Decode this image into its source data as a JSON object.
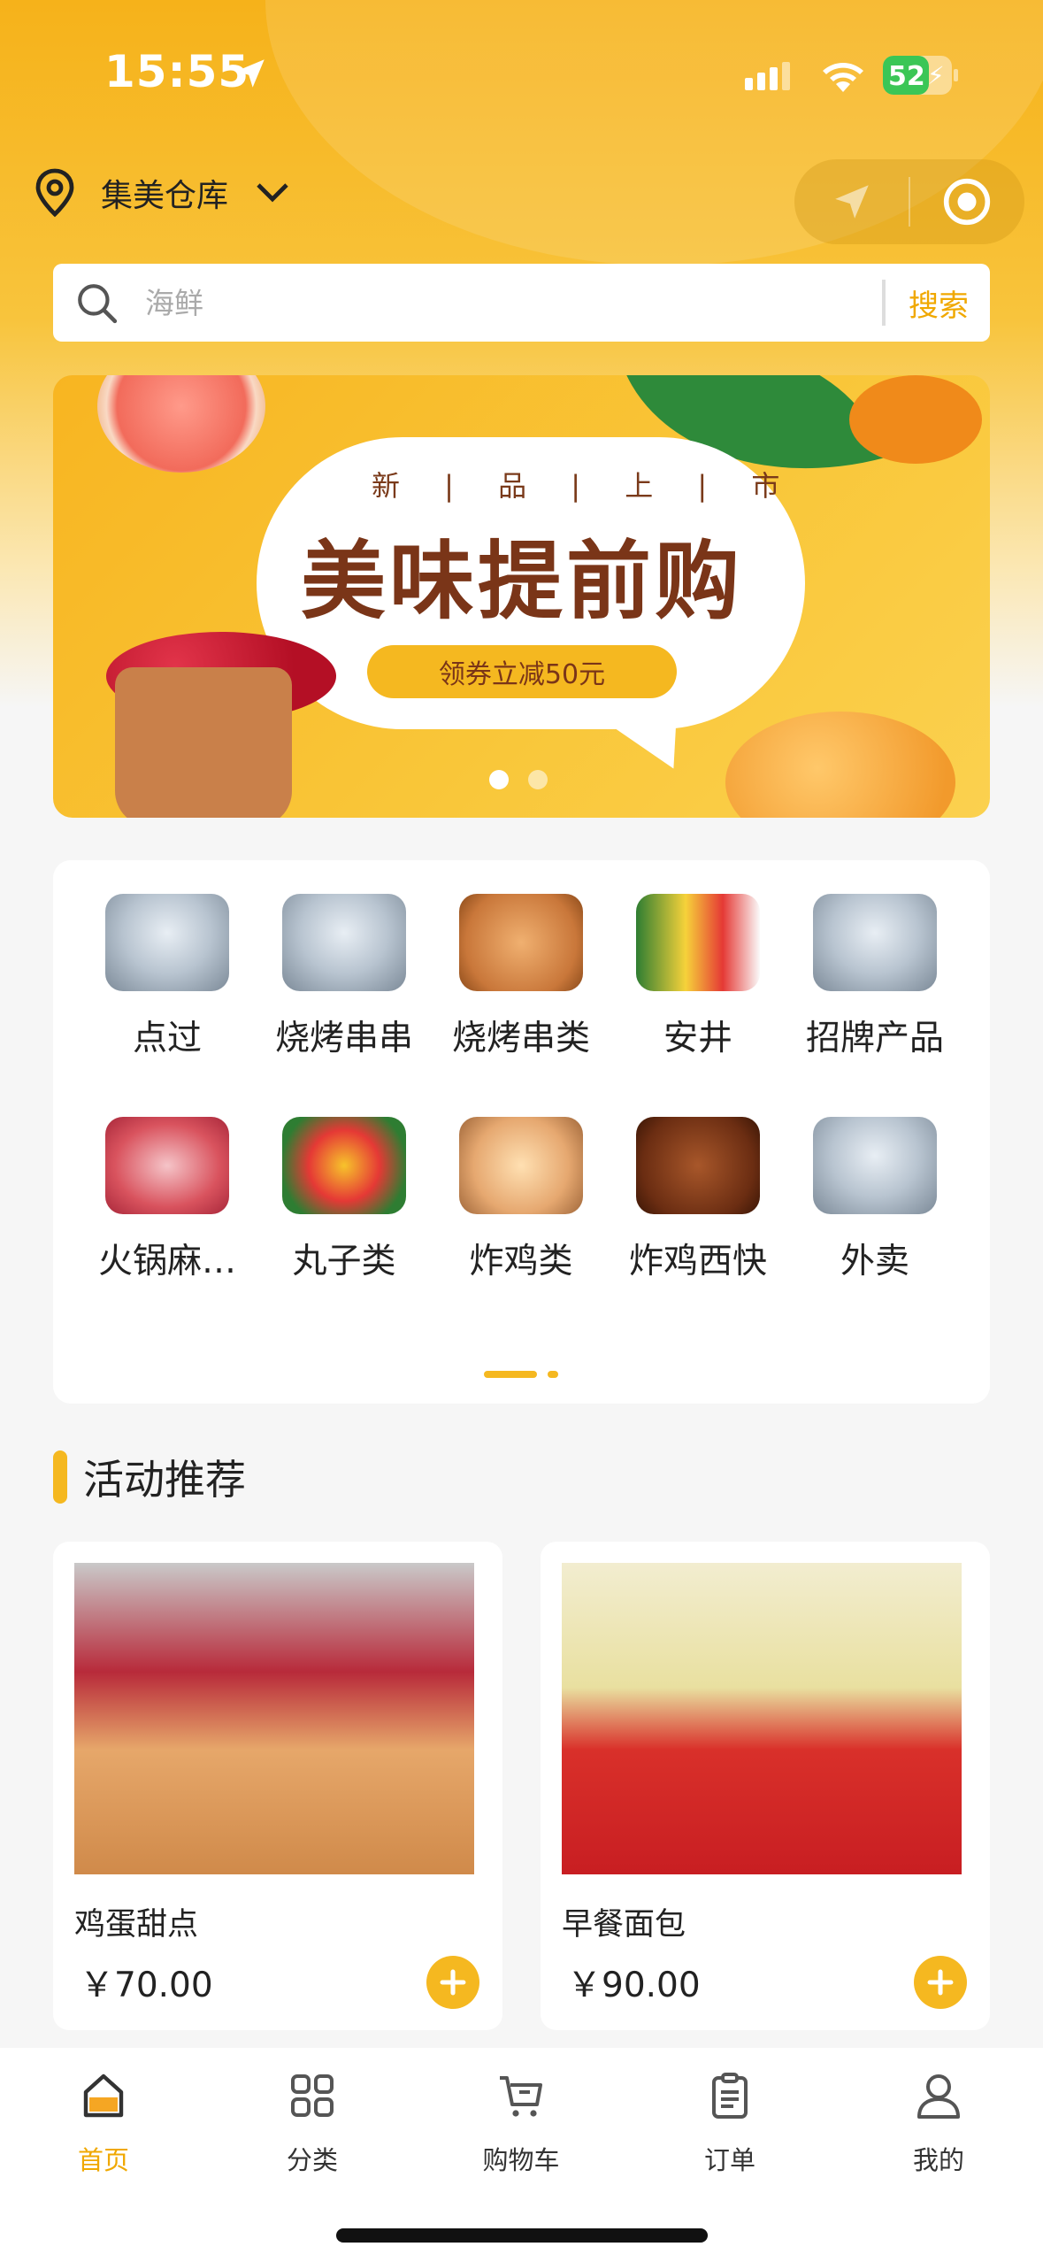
{
  "status_bar": {
    "time": "15:55",
    "battery": "52"
  },
  "header": {
    "location": "集美仓库"
  },
  "search": {
    "placeholder": "海鲜",
    "button": "搜索"
  },
  "banner": {
    "subtitle": "新 | 品 | 上 | 市",
    "headline": "美味提前购",
    "coupon": "领券立减50元",
    "slide_count": 2,
    "active_slide": 0
  },
  "categories": [
    {
      "label": "点过",
      "image": "fish"
    },
    {
      "label": "烧烤串串",
      "image": "fish"
    },
    {
      "label": "烧烤串类",
      "image": "bread"
    },
    {
      "label": "安井",
      "image": "grocery"
    },
    {
      "label": "招牌产品",
      "image": "fish"
    },
    {
      "label": "火锅麻…",
      "image": "meat"
    },
    {
      "label": "丸子类",
      "image": "vegetables"
    },
    {
      "label": "炸鸡类",
      "image": "eggs"
    },
    {
      "label": "炸鸡西快",
      "image": "chicken"
    },
    {
      "label": "外卖",
      "image": "fish"
    }
  ],
  "section": {
    "title": "活动推荐"
  },
  "products": [
    {
      "name": "鸡蛋甜点",
      "price": "￥70.00"
    },
    {
      "name": "早餐面包",
      "price": "￥90.00"
    }
  ],
  "tabbar": {
    "items": [
      {
        "label": "首页",
        "icon": "home-icon",
        "active": true
      },
      {
        "label": "分类",
        "icon": "grid-icon",
        "active": false
      },
      {
        "label": "购物车",
        "icon": "cart-icon",
        "active": false
      },
      {
        "label": "订单",
        "icon": "clipboard-icon",
        "active": false
      },
      {
        "label": "我的",
        "icon": "user-icon",
        "active": false
      }
    ]
  },
  "colors": {
    "accent": "#f5b820",
    "accent_text": "#f0a800"
  }
}
